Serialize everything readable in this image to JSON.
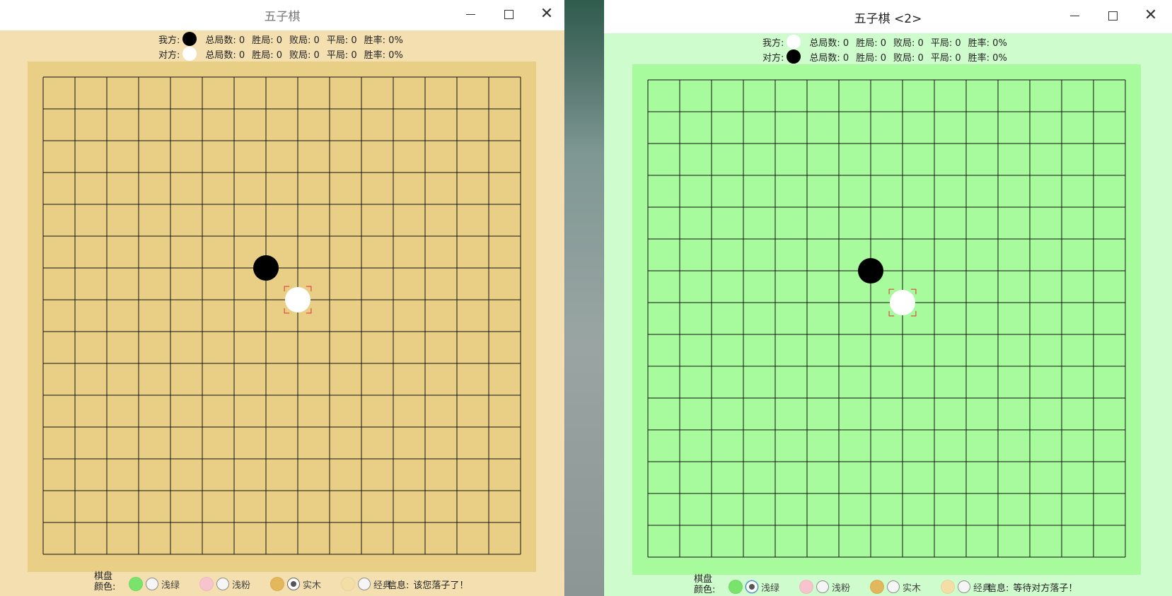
{
  "windows": [
    {
      "title": "五子棋",
      "status": {
        "me_label": "我方:",
        "opp_label": "对方:",
        "me_stone": "black",
        "opp_stone": "white",
        "stat_labels": [
          "总局数:",
          "胜局:",
          "败局:",
          "平局:",
          "胜率:"
        ],
        "me_stats": [
          "0",
          "0",
          "0",
          "0",
          "0%"
        ],
        "opp_stats": [
          "0",
          "0",
          "0",
          "0",
          "0%"
        ]
      },
      "board_color": "#e9cf86",
      "outer_bg": "#f3dfb0",
      "footer": {
        "label_line1": "棋盘",
        "label_line2": "颜色:",
        "options": [
          {
            "label": "浅绿",
            "color": "#79e36b",
            "selected": false
          },
          {
            "label": "浅粉",
            "color": "#f7c4cd",
            "selected": false
          },
          {
            "label": "实木",
            "color": "#e3b75b",
            "selected": true
          },
          {
            "label": "经典",
            "color": "#f3dfa6",
            "selected": false
          }
        ],
        "info_label": "信息:",
        "info_text": "该您落子了！"
      },
      "stones": [
        {
          "row": 6,
          "col": 7,
          "color": "black"
        },
        {
          "row": 7,
          "col": 8,
          "color": "white",
          "last_move": true
        }
      ]
    },
    {
      "title": "五子棋 <2>",
      "status": {
        "me_label": "我方:",
        "opp_label": "对方:",
        "me_stone": "white",
        "opp_stone": "black",
        "stat_labels": [
          "总局数:",
          "胜局:",
          "败局:",
          "平局:",
          "胜率:"
        ],
        "me_stats": [
          "0",
          "0",
          "0",
          "0",
          "0%"
        ],
        "opp_stats": [
          "0",
          "0",
          "0",
          "0",
          "0%"
        ]
      },
      "board_color": "#a7fb9d",
      "outer_bg": "#cffccc",
      "footer": {
        "label_line1": "棋盘",
        "label_line2": "颜色:",
        "options": [
          {
            "label": "浅绿",
            "color": "#79e36b",
            "selected": true
          },
          {
            "label": "浅粉",
            "color": "#f7c4cd",
            "selected": false
          },
          {
            "label": "实木",
            "color": "#e3b75b",
            "selected": false
          },
          {
            "label": "经典",
            "color": "#f3dfa6",
            "selected": false
          }
        ],
        "info_label": "信息:",
        "info_text": "等待对方落子！"
      },
      "stones": [
        {
          "row": 6,
          "col": 7,
          "color": "black"
        },
        {
          "row": 7,
          "col": 8,
          "color": "white",
          "last_move": true
        }
      ]
    }
  ]
}
